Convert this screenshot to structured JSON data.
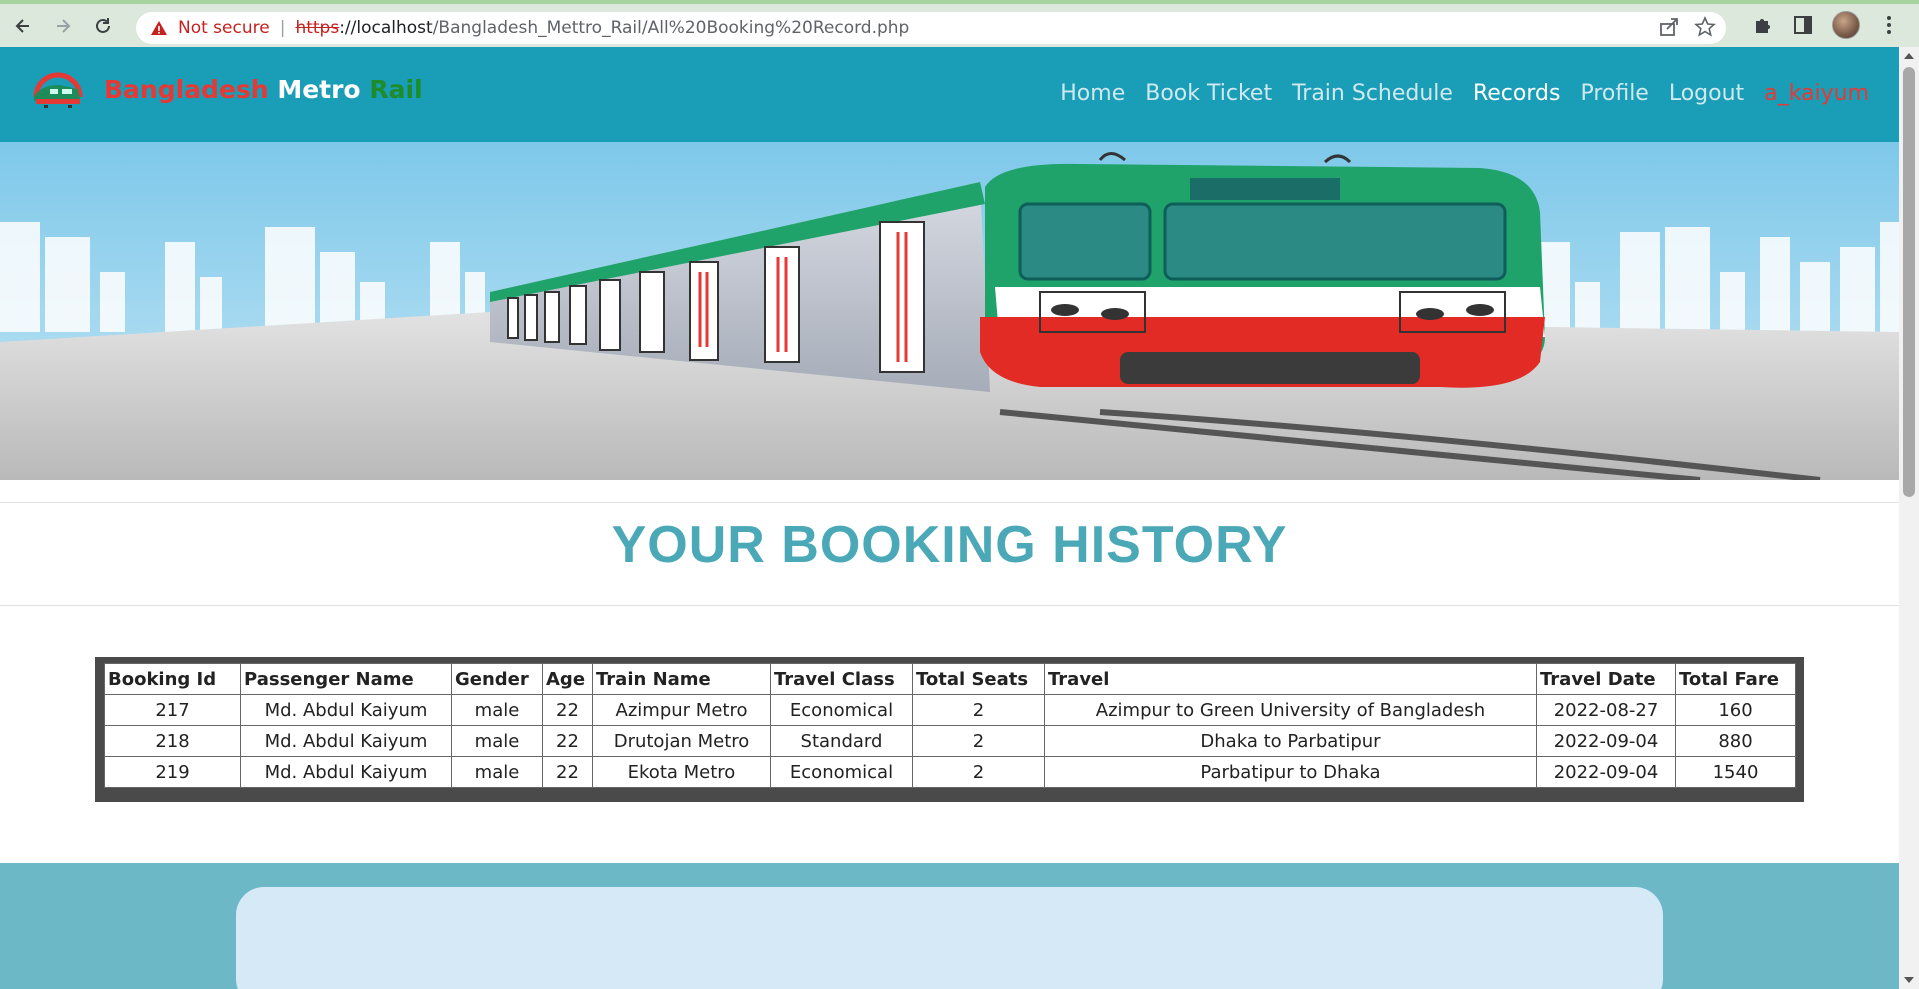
{
  "browser": {
    "security_label": "Not secure",
    "url_protocol": "https",
    "url_host": "://localhost",
    "url_path": "/Bangladesh_Mettro_Rail/All%20Booking%20Record.php"
  },
  "site": {
    "brand_part1": "Bangladesh",
    "brand_part2": "Metro",
    "brand_part3": "Rail",
    "nav": {
      "home": "Home",
      "book_ticket": "Book Ticket",
      "train_schedule": "Train Schedule",
      "records": "Records",
      "profile": "Profile",
      "logout": "Logout",
      "user": "a_kaiyum"
    },
    "brand_colors": {
      "primary": "#1a9db7",
      "accent_red": "#e53935",
      "accent_green": "#1e8c2a",
      "title": "#4aa8b7"
    }
  },
  "page": {
    "title": "YOUR BOOKING HISTORY"
  },
  "table": {
    "headers": [
      "Booking Id",
      "Passenger Name",
      "Gender",
      "Age",
      "Train Name",
      "Travel Class",
      "Total Seats",
      "Travel",
      "Travel Date",
      "Total Fare"
    ],
    "rows": [
      [
        "217",
        "Md. Abdul Kaiyum",
        "male",
        "22",
        "Azimpur Metro",
        "Economical",
        "2",
        "Azimpur to Green University of Bangladesh",
        "2022-08-27",
        "160"
      ],
      [
        "218",
        "Md. Abdul Kaiyum",
        "male",
        "22",
        "Drutojan Metro",
        "Standard",
        "2",
        "Dhaka to Parbatipur",
        "2022-09-04",
        "880"
      ],
      [
        "219",
        "Md. Abdul Kaiyum",
        "male",
        "22",
        "Ekota Metro",
        "Economical",
        "2",
        "Parbatipur to Dhaka",
        "2022-09-04",
        "1540"
      ]
    ]
  }
}
